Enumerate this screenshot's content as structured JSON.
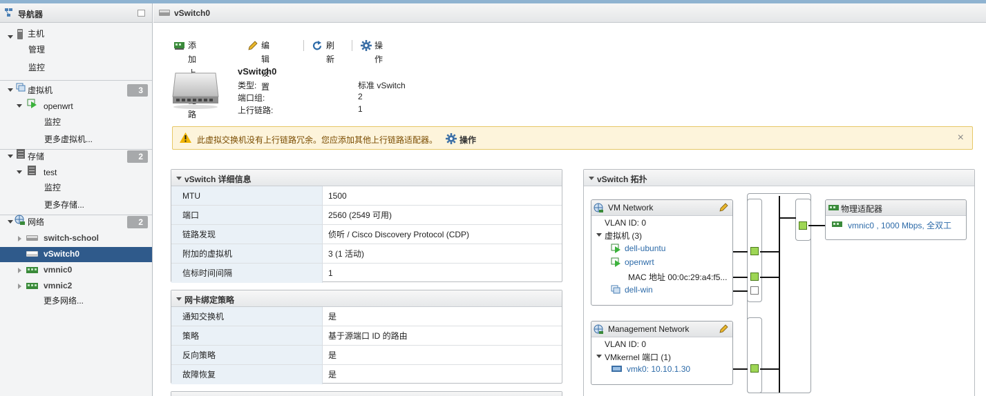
{
  "navigator": {
    "title": "导航器",
    "host": {
      "label": "主机",
      "children": [
        "管理",
        "监控"
      ]
    },
    "vms": {
      "label": "虚拟机",
      "count": "3",
      "vm_name": "openwrt",
      "vm_children": [
        "监控"
      ],
      "more": "更多虚拟机..."
    },
    "storage": {
      "label": "存储",
      "count": "2",
      "ds_name": "test",
      "ds_children": [
        "监控"
      ],
      "more": "更多存储..."
    },
    "network": {
      "label": "网络",
      "count": "2",
      "items": [
        "switch-school",
        "vSwitch0",
        "vmnic0",
        "vmnic2"
      ],
      "more": "更多网络...",
      "selected": "vSwitch0"
    }
  },
  "content": {
    "title": "vSwitch0",
    "toolbar": {
      "add_uplink": "添加上行链路",
      "edit_settings": "编辑设置",
      "refresh": "刷新",
      "actions": "操作"
    },
    "summary": {
      "name": "vSwitch0",
      "rows": [
        {
          "key": "类型:",
          "value": "标准 vSwitch"
        },
        {
          "key": "端口组:",
          "value": "2"
        },
        {
          "key": "上行链路:",
          "value": "1"
        }
      ]
    },
    "warning": {
      "text": "此虚拟交换机没有上行链路冗余。您应添加其他上行链路适配器。",
      "action": "操作"
    },
    "details": {
      "title": "vSwitch 详细信息",
      "rows": [
        {
          "key": "MTU",
          "value": "1500"
        },
        {
          "key": "端口",
          "value": "2560 (2549 可用)"
        },
        {
          "key": "链路发现",
          "value": "侦听 / Cisco Discovery Protocol (CDP)"
        },
        {
          "key": "附加的虚拟机",
          "value": "3 (1 活动)"
        },
        {
          "key": "信标时间间隔",
          "value": "1"
        }
      ]
    },
    "teaming": {
      "title": "网卡绑定策略",
      "rows": [
        {
          "key": "通知交换机",
          "value": "是"
        },
        {
          "key": "策略",
          "value": "基于源端口 ID 的路由"
        },
        {
          "key": "反向策略",
          "value": "是"
        },
        {
          "key": "故障恢复",
          "value": "是"
        }
      ]
    },
    "topology": {
      "title": "vSwitch 拓扑",
      "vm_network": {
        "name": "VM Network",
        "vlan": "VLAN ID: 0",
        "vms_label": "虚拟机 (3)",
        "vms": [
          "dell-ubuntu",
          "openwrt",
          "dell-win"
        ],
        "mac": "MAC 地址 00:0c:29:a4:f5..."
      },
      "mgmt_network": {
        "name": "Management Network",
        "vlan": "VLAN ID: 0",
        "vmk_label": "VMkernel 端口 (1)",
        "vmk": "vmk0: 10.10.1.30"
      },
      "physical": {
        "title": "物理适配器",
        "nic": "vmnic0 , 1000 Mbps, 全双工"
      }
    }
  },
  "colors": {
    "selected_bg": "#2f5a8b",
    "link": "#2c6aa8",
    "warning_bg": "#fdf4db",
    "port_green": "#9ed655"
  }
}
